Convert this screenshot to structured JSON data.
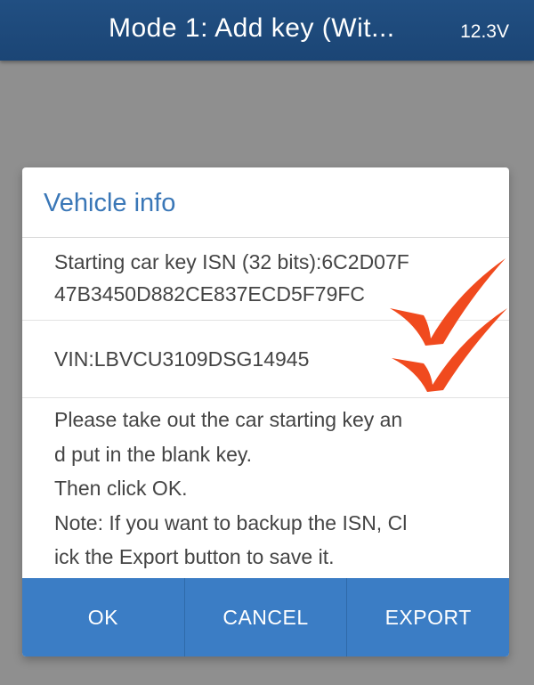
{
  "topbar": {
    "title": "Mode 1: Add key (Wit...",
    "voltage": "12.3V"
  },
  "dialog": {
    "title": "Vehicle info",
    "isn_lines": [
      "Starting car key ISN (32 bits):6C2D07F",
      "47B3450D882CE837ECD5F79FC"
    ],
    "vin": "VIN:LBVCU3109DSG14945",
    "message_lines": [
      "Please take out the car starting key an",
      "d put in the blank key.",
      "Then click OK.",
      "Note: If you want to backup the ISN, Cl",
      "ick the Export button to save it."
    ],
    "buttons": {
      "ok": "OK",
      "cancel": "CANCEL",
      "export": "EXPORT"
    }
  },
  "colors": {
    "topbar": "#1b4575",
    "accent": "#3a77b7",
    "button_bar": "#3b7dc5",
    "checkmark": "#f04a1e"
  },
  "icons": [
    "checkmark-icon",
    "checkmark-icon"
  ]
}
